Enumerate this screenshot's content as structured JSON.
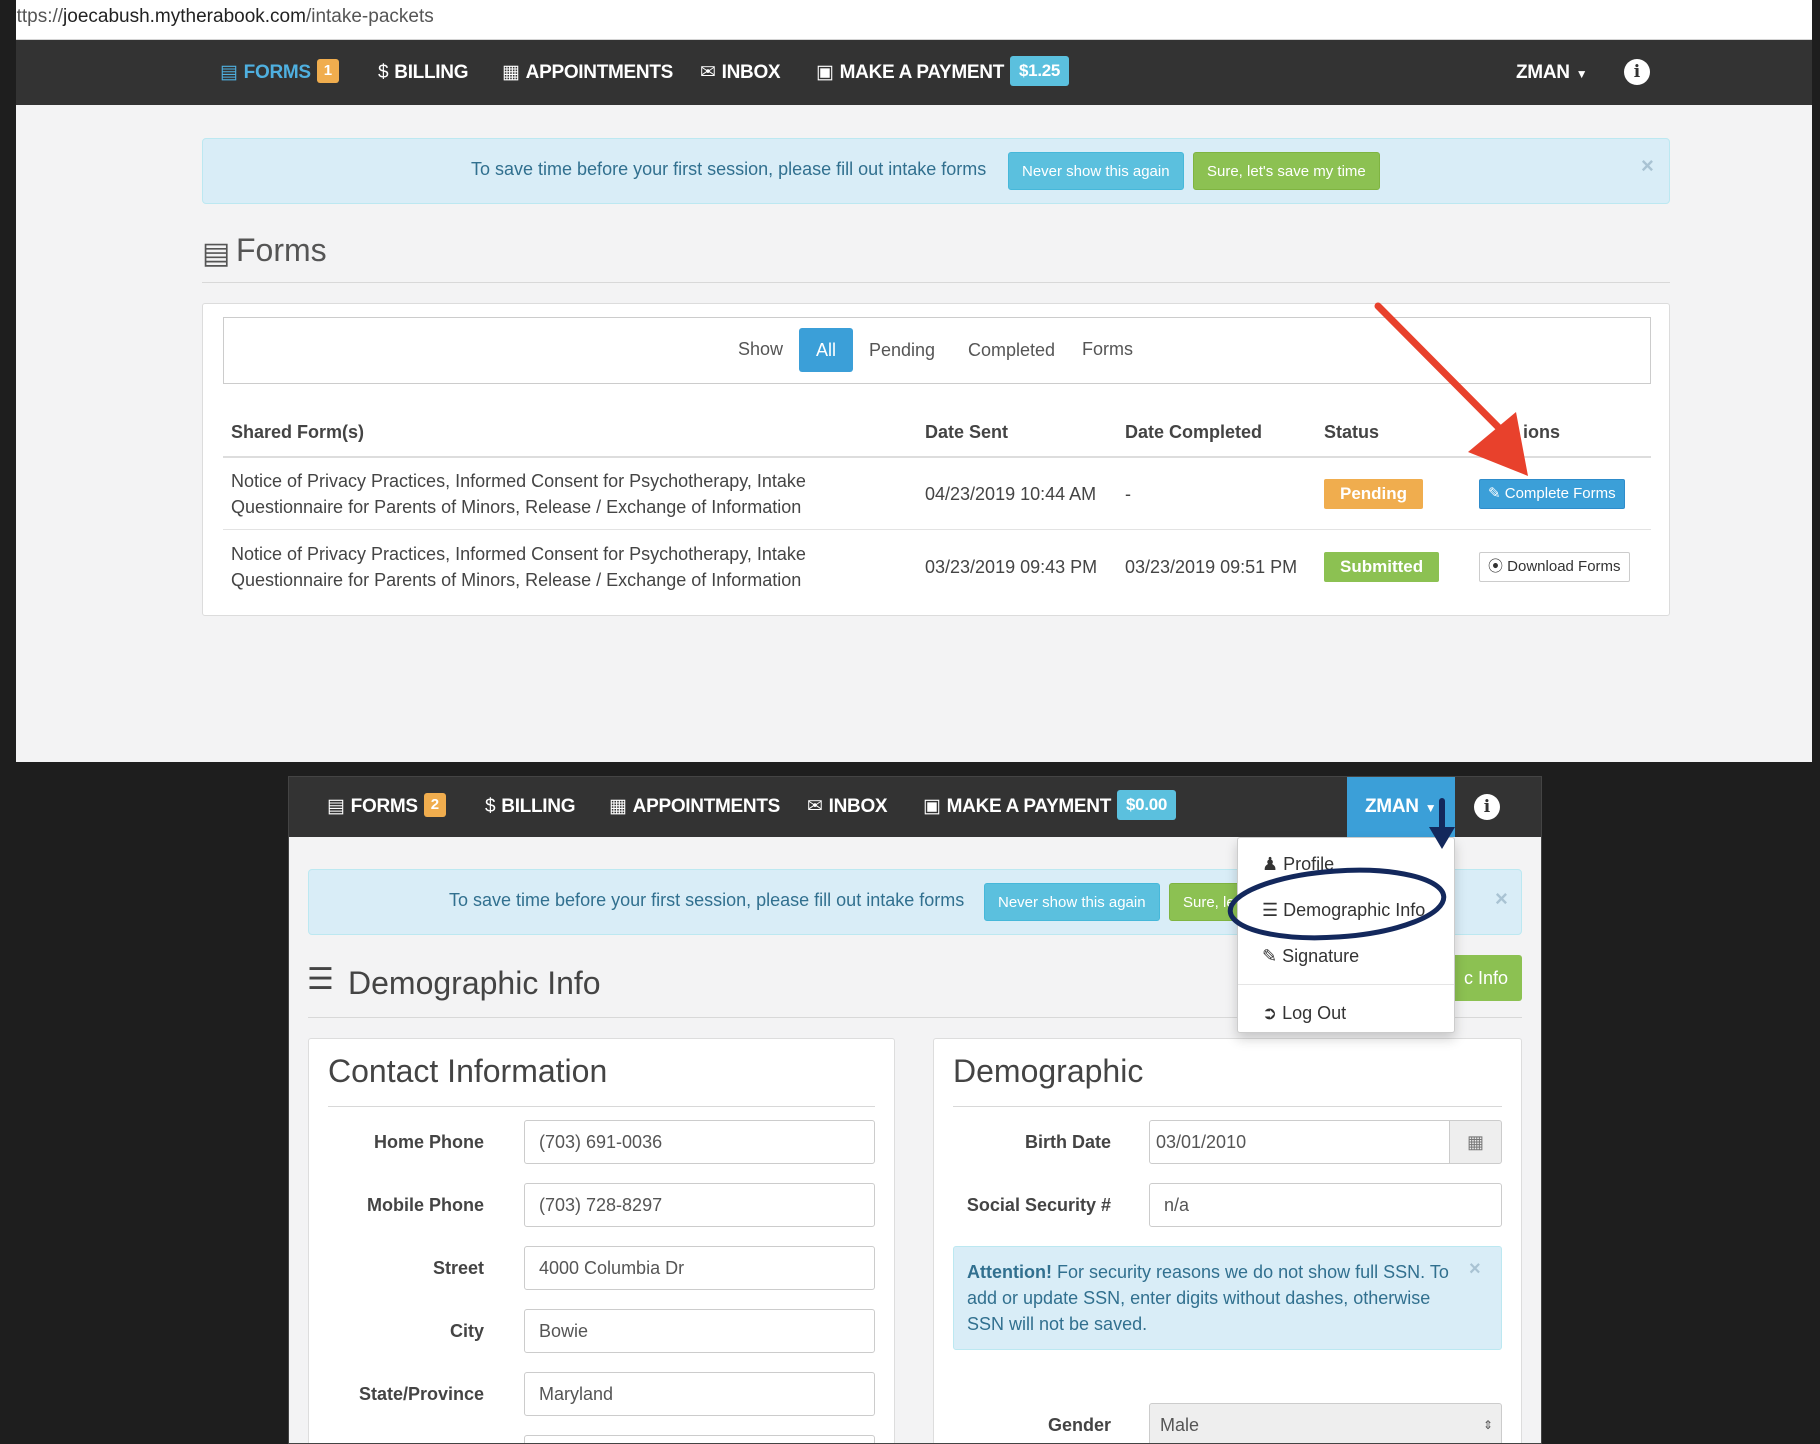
{
  "browser": {
    "url_prefix": "https://",
    "url_host": "joecabush.mytherabook.com",
    "url_path": "/intake-packets"
  },
  "window1": {
    "nav": {
      "forms_label": "FORMS",
      "forms_badge": "1",
      "billing_label": "BILLING",
      "appointments_label": "APPOINTMENTS",
      "inbox_label": "INBOX",
      "payment_label": "MAKE A PAYMENT",
      "payment_amount": "$1.25",
      "user_label": "ZMAN",
      "info_glyph": "i"
    },
    "alert": {
      "message": "To save time before your first session, please fill out intake forms",
      "never_label": "Never show this again",
      "sure_label": "Sure, let's save my time",
      "close": "×"
    },
    "page_title": "Forms",
    "filter": {
      "show_label": "Show",
      "options": [
        "All",
        "Pending",
        "Completed",
        "Forms"
      ],
      "selected": "All"
    },
    "table": {
      "headers": [
        "Shared Form(s)",
        "Date Sent",
        "Date Completed",
        "Status",
        "ions"
      ],
      "rows": [
        {
          "forms_line1": "Notice of Privacy Practices, Informed Consent for Psychotherapy, Intake",
          "forms_line2": "Questionnaire for Parents of Minors, Release / Exchange of Information",
          "date_sent": "04/23/2019 10:44 AM",
          "date_completed": "-",
          "status": "Pending",
          "action": "Complete Forms"
        },
        {
          "forms_line1": "Notice of Privacy Practices, Informed Consent for Psychotherapy, Intake",
          "forms_line2": "Questionnaire for Parents of Minors, Release / Exchange of Information",
          "date_sent": "03/23/2019 09:43 PM",
          "date_completed": "03/23/2019 09:51 PM",
          "status": "Submitted",
          "action": "Download Forms"
        }
      ]
    },
    "colors": {
      "arrow": "#e8412c",
      "pending": "#f0ad4e",
      "submitted": "#8cc152",
      "primary": "#3b9fd8"
    }
  },
  "window2": {
    "nav": {
      "forms_label": "FORMS",
      "forms_badge": "2",
      "billing_label": "BILLING",
      "appointments_label": "APPOINTMENTS",
      "inbox_label": "INBOX",
      "payment_label": "MAKE A PAYMENT",
      "payment_amount": "$0.00",
      "user_label": "ZMAN",
      "info_glyph": "i"
    },
    "alert": {
      "message": "To save time before your first session, please fill out intake forms",
      "never_label": "Never show this again",
      "sure_label_partial": "Sure, le",
      "close": "×"
    },
    "page_title": "Demographic Info",
    "edit_button_partial": "c Info",
    "dropdown": {
      "items": [
        "Profile",
        "Demographic Info",
        "Signature",
        "Log Out"
      ]
    },
    "contact": {
      "title": "Contact Information",
      "fields": [
        {
          "label": "Home Phone",
          "value": "(703) 691-0036"
        },
        {
          "label": "Mobile Phone",
          "value": "(703) 728-8297"
        },
        {
          "label": "Street",
          "value": "4000 Columbia Dr"
        },
        {
          "label": "City",
          "value": "Bowie"
        },
        {
          "label": "State/Province",
          "value": "Maryland"
        }
      ]
    },
    "demographic": {
      "title": "Demographic",
      "birth_date_label": "Birth Date",
      "birth_date_value": "03/01/2010",
      "ssn_label": "Social Security #",
      "ssn_value": "n/a",
      "attention_strong": "Attention!",
      "attention_text": " For security reasons we do not show full SSN. To add or update SSN, enter digits without dashes, otherwise SSN will not be saved.",
      "attention_close": "×",
      "gender_label": "Gender",
      "gender_value": "Male"
    },
    "colors": {
      "annotation": "#13285c"
    }
  }
}
